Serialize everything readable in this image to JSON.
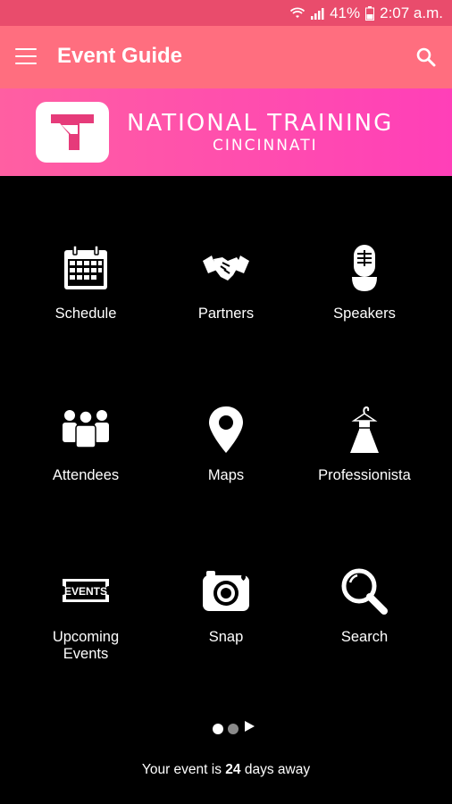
{
  "status_bar": {
    "battery": "41%",
    "time": "2:07 a.m.",
    "icons": [
      "wifi-icon",
      "signal-icon",
      "battery-icon"
    ]
  },
  "app_bar": {
    "title": "Event Guide",
    "icons": [
      "menu-icon",
      "search-icon"
    ]
  },
  "banner": {
    "title": "NATIONAL TRAINING",
    "subtitle": "CINCINNATI",
    "logo_icon": "t-logo-icon"
  },
  "tiles": [
    {
      "label": "Schedule",
      "icon": "calendar-icon"
    },
    {
      "label": "Partners",
      "icon": "handshake-icon"
    },
    {
      "label": "Speakers",
      "icon": "microphone-icon"
    },
    {
      "label": "Attendees",
      "icon": "people-icon"
    },
    {
      "label": "Maps",
      "icon": "map-pin-icon"
    },
    {
      "label": "Professionista",
      "icon": "dress-icon"
    },
    {
      "label": "Upcoming\nEvents",
      "icon": "events-ticket-icon"
    },
    {
      "label": "Snap",
      "icon": "camera-icon"
    },
    {
      "label": "Search",
      "icon": "magnifier-icon"
    }
  ],
  "pager": {
    "pages": 2,
    "current": 1
  },
  "footer": {
    "prefix": "Your event is",
    "days": "24",
    "suffix": "days away"
  },
  "colors": {
    "status_bar": "#e94c6c",
    "app_bar": "#ff6e7f",
    "banner": "#ff4fae",
    "background": "#000000"
  }
}
